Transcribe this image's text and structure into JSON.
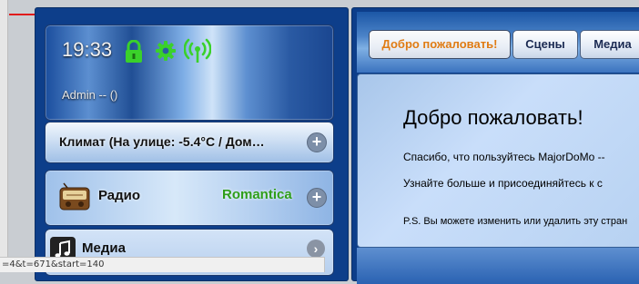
{
  "status_widget": {
    "time": "19:33",
    "user": "Admin -- ()",
    "icons": [
      "lock-icon",
      "gear-icon",
      "wifi-signal-icon"
    ],
    "accent_color": "#3ad12a"
  },
  "climate_widget": {
    "label": "Климат (На улице: -5.4°C / Дом…",
    "action": "+"
  },
  "radio_widget": {
    "label": "Радио",
    "station": "Romantica",
    "station_color": "#2e9e1a",
    "action": "+"
  },
  "media_widget": {
    "label": "Медиа",
    "action": "›"
  },
  "tabs": [
    {
      "label": "Добро пожаловать!",
      "active": true
    },
    {
      "label": "Сцены",
      "active": false
    },
    {
      "label": "Медиа",
      "active": false
    }
  ],
  "welcome": {
    "title": "Добро пожаловать!",
    "line1": "Спасибо, что пользуйтесь MajorDoMo --",
    "line2": "Узнайте больше и присоединяйтесь к с",
    "ps": "P.S. Вы можете изменить или удалить эту стран"
  },
  "statusbar": {
    "url": "=4&t=671&start=140"
  }
}
